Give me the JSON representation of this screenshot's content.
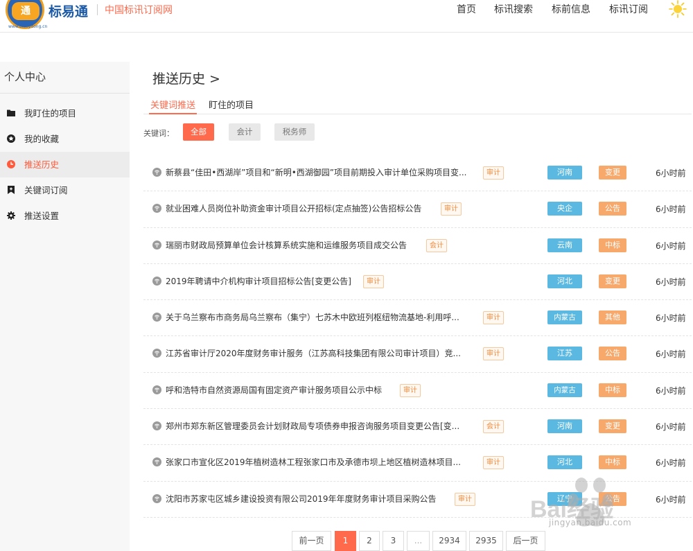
{
  "header": {
    "logo_char": "通",
    "logo_url": "www.biaoyitong.cn",
    "brand": "标易通",
    "slogan": "中国标讯订阅网",
    "nav": [
      "首页",
      "标讯搜索",
      "标前信息",
      "标讯订阅"
    ]
  },
  "sidebar": {
    "title": "个人中心",
    "items": [
      {
        "label": "我盯住的项目",
        "icon": "folder-icon"
      },
      {
        "label": "我的收藏",
        "icon": "star-icon"
      },
      {
        "label": "推送历史",
        "icon": "clock-icon",
        "active": true
      },
      {
        "label": "关键词订阅",
        "icon": "bookmark-icon"
      },
      {
        "label": "推送设置",
        "icon": "gear-icon"
      }
    ]
  },
  "main": {
    "title": "推送历史 >",
    "tabs": [
      "关键词推送",
      "盯住的项目"
    ],
    "keyword_label": "关键词：",
    "chips": [
      "全部",
      "会计",
      "税务师"
    ]
  },
  "rows": [
    {
      "title": "新蔡县“佳田•西湖岸”项目和“新明•西湖御园”项目前期投入审计单位采购项目变...",
      "tag": "审计",
      "region": "河南",
      "type": "变更",
      "time": "6小时前"
    },
    {
      "title": "就业困难人员岗位补助资金审计项目公开招标(定点抽签)公告招标公告",
      "tag": "审计",
      "region": "央企",
      "type": "公告",
      "time": "6小时前"
    },
    {
      "title": "瑞丽市财政局预算单位会计核算系统实施和运维服务项目成交公告",
      "tag": "会计",
      "region": "云南",
      "type": "中标",
      "time": "6小时前"
    },
    {
      "title": "2019年聘请中介机构审计项目招标公告[变更公告]",
      "tag": "审计",
      "region": "河北",
      "type": "变更",
      "time": "6小时前"
    },
    {
      "title": "关于乌兰察布市商务局乌兰察布（集宁）七苏木中欧班列枢纽物流基地-利用呼...",
      "tag": "审计",
      "region": "内蒙古",
      "type": "其他",
      "time": "6小时前"
    },
    {
      "title": "江苏省审计厅2020年度财务审计服务（江苏高科技集团有限公司审计项目）竞...",
      "tag": "审计",
      "region": "江苏",
      "type": "公告",
      "time": "6小时前"
    },
    {
      "title": "呼和浩特市自然资源局国有固定资产审计服务项目公示中标",
      "tag": "审计",
      "region": "内蒙古",
      "type": "中标",
      "time": "6小时前"
    },
    {
      "title": "郑州市郑东新区管理委员会计划财政局专项债券申报咨询服务项目变更公告[变...",
      "tag": "会计",
      "region": "河南",
      "type": "变更",
      "time": "6小时前"
    },
    {
      "title": "张家口市宣化区2019年植树造林工程张家口市及承德市坝上地区植树造林项目...",
      "tag": "审计",
      "region": "河北",
      "type": "中标",
      "time": "6小时前"
    },
    {
      "title": "沈阳市苏家屯区城乡建设投资有限公司2019年年度财务审计项目采购公告",
      "tag": "审计",
      "region": "辽宁",
      "type": "公告",
      "time": "6小时前"
    }
  ],
  "pagination": {
    "prev": "前一页",
    "pages": [
      "1",
      "2",
      "3",
      "...",
      "2934",
      "2935"
    ],
    "next": "后一页",
    "current": "1"
  },
  "watermark": {
    "text": "jingyan.baidu.com",
    "brand": "Bai经验"
  },
  "colors": {
    "accent": "#ff6a4d",
    "region": "#5bb8e0",
    "type": "#f7a86b",
    "brand": "#1c5aa6"
  }
}
